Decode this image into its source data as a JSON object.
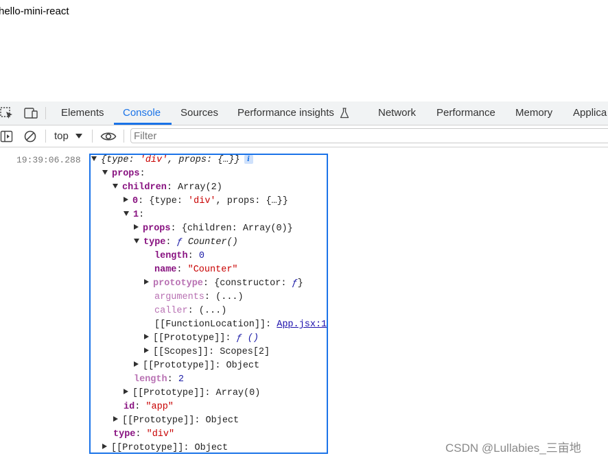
{
  "page": {
    "text": "hello-mini-react"
  },
  "devtools": {
    "tabs": [
      "Elements",
      "Console",
      "Sources",
      "Performance insights",
      "Network",
      "Performance",
      "Memory",
      "Applica"
    ],
    "active_tab": "Console",
    "context": "top",
    "filter_placeholder": "Filter"
  },
  "console": {
    "timestamp": "19:39:06.288",
    "rows": [
      {
        "expand": "down",
        "parts": [
          [
            "it",
            "{type: "
          ],
          [
            "str it",
            "'div'"
          ],
          [
            "it",
            ", props: {…}}"
          ]
        ],
        "badge": "i"
      },
      {
        "expand": "down",
        "parts": [
          [
            "k",
            "props"
          ],
          [
            "",
            ":"
          ]
        ]
      },
      {
        "expand": "down",
        "parts": [
          [
            "k",
            "children"
          ],
          [
            "",
            ": Array(2)"
          ]
        ]
      },
      {
        "expand": "right",
        "parts": [
          [
            "k",
            "0"
          ],
          [
            "",
            ": {type: "
          ],
          [
            "str",
            "'div'"
          ],
          [
            "",
            ", props: {…}}"
          ]
        ]
      },
      {
        "expand": "down",
        "parts": [
          [
            "k",
            "1"
          ],
          [
            "",
            ":"
          ]
        ]
      },
      {
        "expand": "right",
        "parts": [
          [
            "k",
            "props"
          ],
          [
            "",
            ": {children: Array(0)}"
          ]
        ]
      },
      {
        "expand": "down",
        "parts": [
          [
            "k",
            "type"
          ],
          [
            "",
            ": "
          ],
          [
            "fkw",
            "ƒ"
          ],
          [
            "it",
            " Counter()"
          ]
        ]
      },
      {
        "expand": "",
        "parts": [
          [
            "k",
            "length"
          ],
          [
            "",
            ": "
          ],
          [
            "num",
            "0"
          ]
        ]
      },
      {
        "expand": "",
        "parts": [
          [
            "k",
            "name"
          ],
          [
            "",
            ": "
          ],
          [
            "str",
            "\"Counter\""
          ]
        ]
      },
      {
        "expand": "right",
        "parts": [
          [
            "kd",
            "prototype"
          ],
          [
            "",
            ": {constructor: "
          ],
          [
            "fkw",
            "ƒ"
          ],
          [
            "",
            "}"
          ]
        ]
      },
      {
        "expand": "",
        "parts": [
          [
            "kdn",
            "arguments"
          ],
          [
            "",
            ": (...)"
          ]
        ]
      },
      {
        "expand": "",
        "parts": [
          [
            "kdn",
            "caller"
          ],
          [
            "",
            ": (...)"
          ]
        ]
      },
      {
        "expand": "",
        "parts": [
          [
            "",
            "[[FunctionLocation]]: "
          ],
          [
            "link",
            "App.jsx:1"
          ]
        ]
      },
      {
        "expand": "right",
        "parts": [
          [
            "",
            "[[Prototype]]: "
          ],
          [
            "fkw",
            "ƒ ()"
          ]
        ]
      },
      {
        "expand": "right",
        "parts": [
          [
            "",
            "[[Scopes]]: Scopes[2]"
          ]
        ]
      },
      {
        "expand": "right",
        "parts": [
          [
            "",
            "[[Prototype]]: Object"
          ]
        ]
      },
      {
        "expand": "",
        "parts": [
          [
            "kd",
            "length"
          ],
          [
            "",
            ": "
          ],
          [
            "num",
            "2"
          ]
        ]
      },
      {
        "expand": "right",
        "parts": [
          [
            "",
            "[[Prototype]]: Array(0)"
          ]
        ]
      },
      {
        "expand": "",
        "parts": [
          [
            "k",
            "id"
          ],
          [
            "",
            ": "
          ],
          [
            "str",
            "\"app\""
          ]
        ]
      },
      {
        "expand": "right",
        "parts": [
          [
            "",
            "[[Prototype]]: Object"
          ]
        ]
      },
      {
        "expand": "",
        "parts": [
          [
            "k",
            "type"
          ],
          [
            "",
            ": "
          ],
          [
            "str",
            "\"div\""
          ]
        ]
      },
      {
        "expand": "right",
        "parts": [
          [
            "",
            "[[Prototype]]: Object"
          ]
        ]
      }
    ]
  },
  "watermark": "CSDN @Lullabies_三亩地",
  "colors": {
    "accent": "#1a73e8",
    "key": "#881280",
    "string": "#c80000",
    "number": "#1a1aa6"
  }
}
